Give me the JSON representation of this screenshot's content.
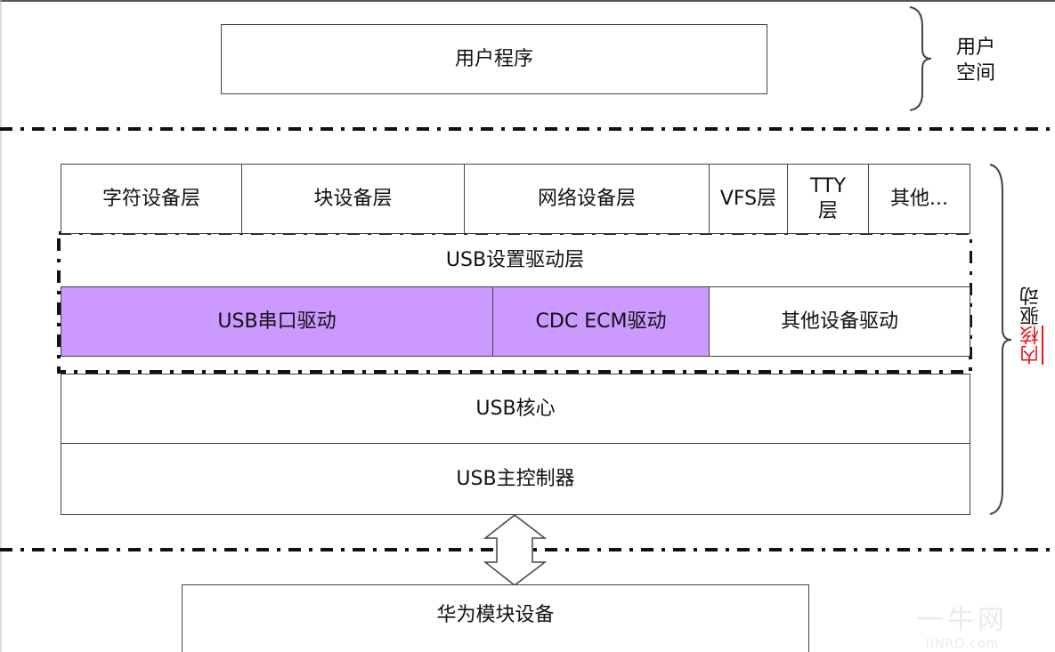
{
  "user_space": {
    "program": "用户程序",
    "label_line1": "用户",
    "label_line2": "空间"
  },
  "kernel": {
    "layers": [
      "字符设备层",
      "块设备层",
      "网络设备层",
      "VFS层",
      "TTY 层",
      "其他..."
    ],
    "usb_gadget_layer": "USB设置驱动层",
    "drivers": [
      "USB串口驱动",
      "CDC ECM驱动",
      "其他设备驱动"
    ],
    "usb_core": "USB核心",
    "usb_host_controller": "USB主控制器",
    "label_highlight": "内核",
    "label_rest": "驱动"
  },
  "device": {
    "label": "华为模块设备"
  },
  "colors": {
    "highlight_fill": "#cc99ff",
    "label_red": "#e8141a"
  },
  "watermark": {
    "line1": "一牛网",
    "line2": "IINRD.com"
  }
}
